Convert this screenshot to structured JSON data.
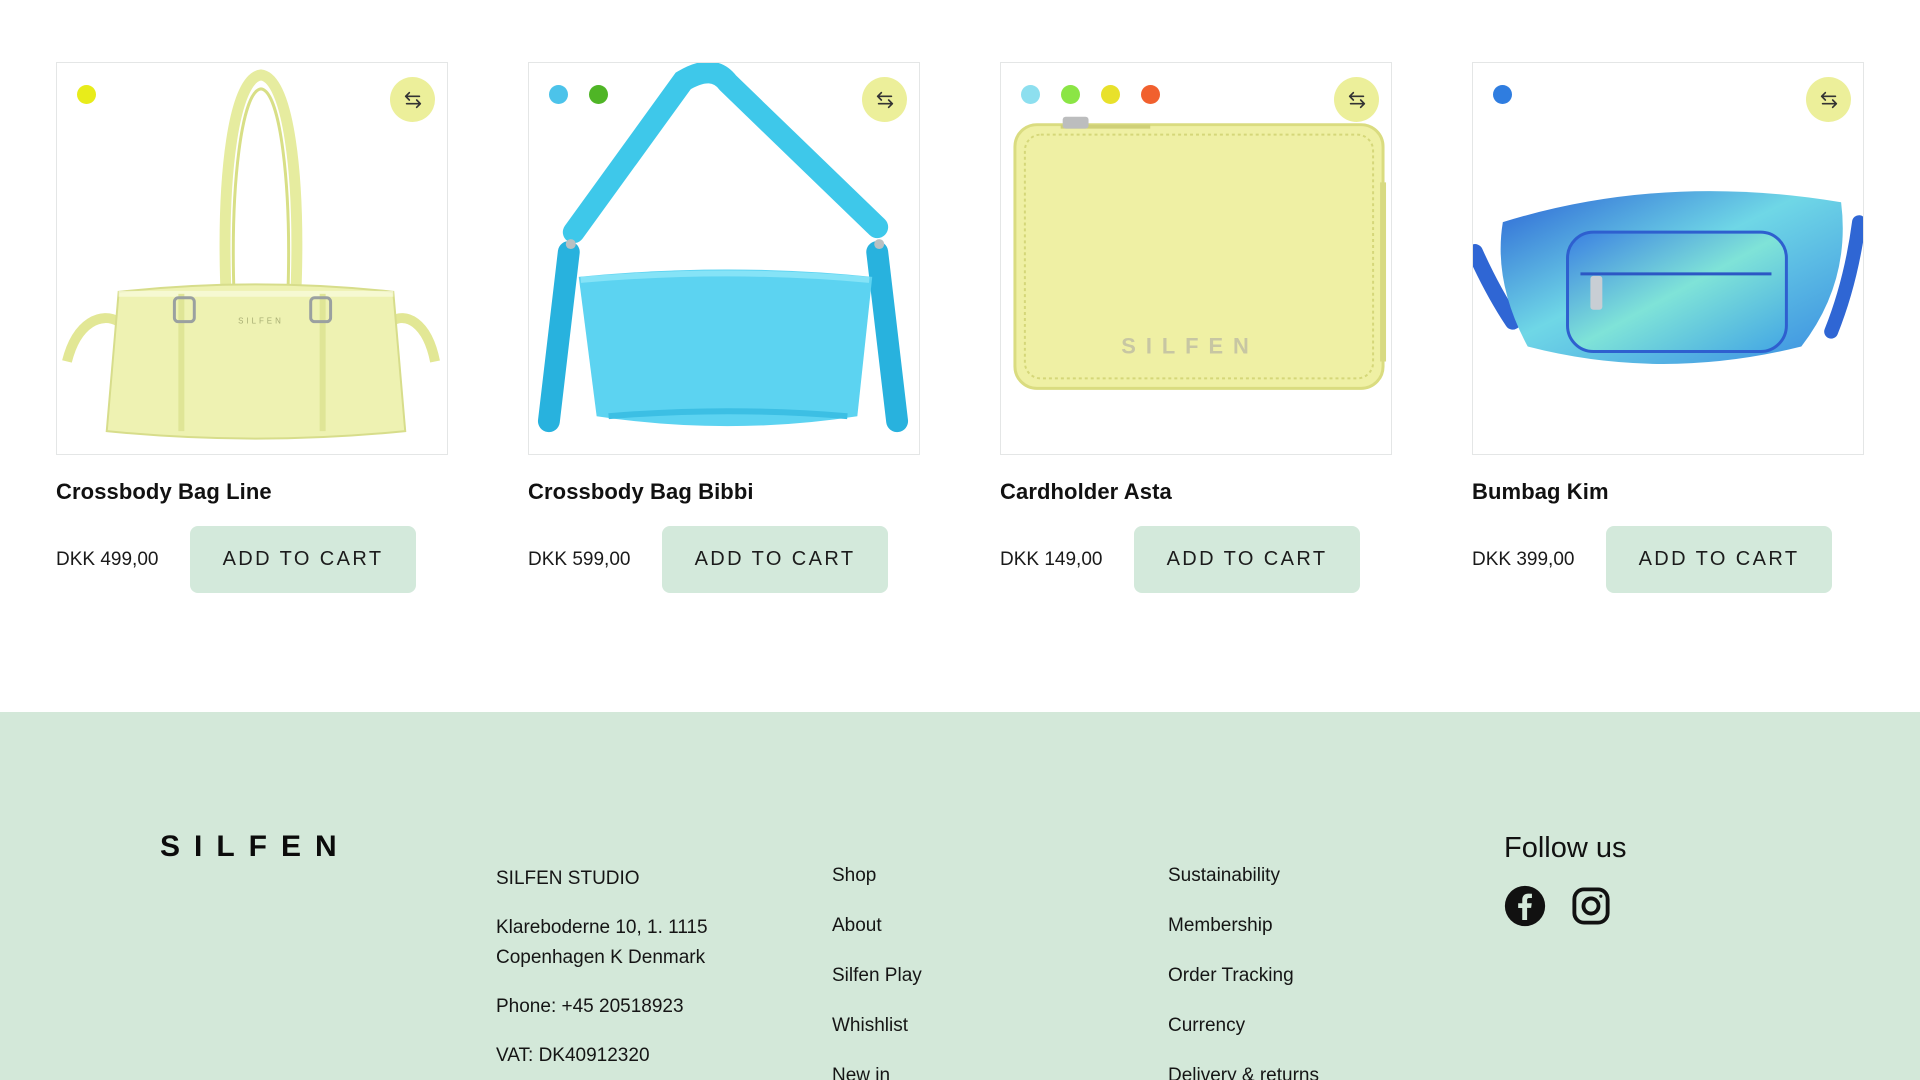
{
  "products": [
    {
      "name": "Crossbody Bag Line",
      "price": "DKK 499,00",
      "cta": "ADD TO CART",
      "swatches": [
        "#e8ec1a"
      ],
      "image_icon": "yellow-patent-shoulder-bag",
      "bag_text": "SILFEN"
    },
    {
      "name": "Crossbody Bag Bibbi",
      "price": "DKK 599,00",
      "cta": "ADD TO CART",
      "swatches": [
        "#4cc3ea",
        "#4fb526"
      ],
      "image_icon": "blue-nylon-shoulder-bag"
    },
    {
      "name": "Cardholder Asta",
      "price": "DKK 149,00",
      "cta": "ADD TO CART",
      "swatches": [
        "#8ddfef",
        "#8be545",
        "#e8e12b",
        "#f1602e"
      ],
      "image_icon": "yellow-patent-cardholder",
      "bag_text": "SILFEN"
    },
    {
      "name": "Bumbag Kim",
      "price": "DKK 399,00",
      "cta": "ADD TO CART",
      "swatches": [
        "#2f7de0"
      ],
      "image_icon": "blue-gradient-bumbag"
    }
  ],
  "colors": {
    "button_bg": "#d3e9db",
    "compare_bg": "#ecef9a",
    "footer_bg": "#d3e8d9"
  },
  "footer": {
    "logo": "SILFEN",
    "studio": {
      "name": "SILFEN STUDIO",
      "address": "Klareboderne 10, 1. 1115 Copenhagen K Denmark",
      "phone": "Phone: +45 20518923",
      "vat": "VAT: DK40912320"
    },
    "shop_links": [
      "Shop",
      "About",
      "Silfen Play",
      "Whishlist",
      "New in"
    ],
    "info_links": [
      "Sustainability",
      "Membership",
      "Order Tracking",
      "Currency",
      "Delivery & returns"
    ],
    "follow_title": "Follow us",
    "social_icons": [
      "facebook-icon",
      "instagram-icon"
    ]
  }
}
